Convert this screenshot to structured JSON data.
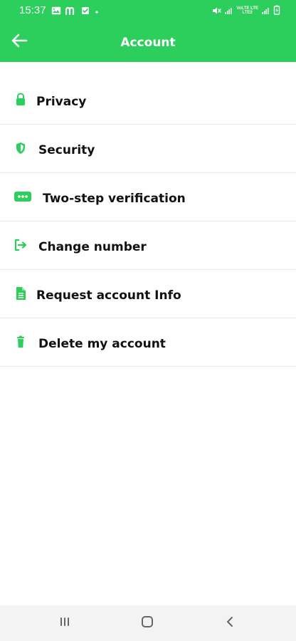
{
  "status_bar": {
    "time": "15:37",
    "left_icons": [
      "image-icon",
      "m-app-icon",
      "check-box-icon",
      "dot-icon"
    ],
    "right_icons": [
      "mute-icon",
      "signal-icon",
      "volte-lte-icon",
      "signal-icon",
      "battery-charging-icon"
    ],
    "network_text_top": "VoLTE LTE",
    "network_text_bottom": "LTE2"
  },
  "header": {
    "title": "Account",
    "back_icon": "arrow-left-icon"
  },
  "colors": {
    "accent": "#2dcf5c",
    "text": "#111111",
    "divider": "#e9ecef",
    "nav_background": "#f3f3f3"
  },
  "menu": {
    "items": [
      {
        "label": "Privacy",
        "icon": "lock-icon"
      },
      {
        "label": "Security",
        "icon": "shield-icon"
      },
      {
        "label": "Two-step verification",
        "icon": "dots-icon"
      },
      {
        "label": "Change number",
        "icon": "change-number-icon"
      },
      {
        "label": "Request account Info",
        "icon": "document-icon"
      },
      {
        "label": "Delete my account",
        "icon": "trash-icon"
      }
    ]
  },
  "nav_bar": {
    "buttons": [
      "recent-apps-icon",
      "home-icon",
      "back-icon"
    ]
  }
}
